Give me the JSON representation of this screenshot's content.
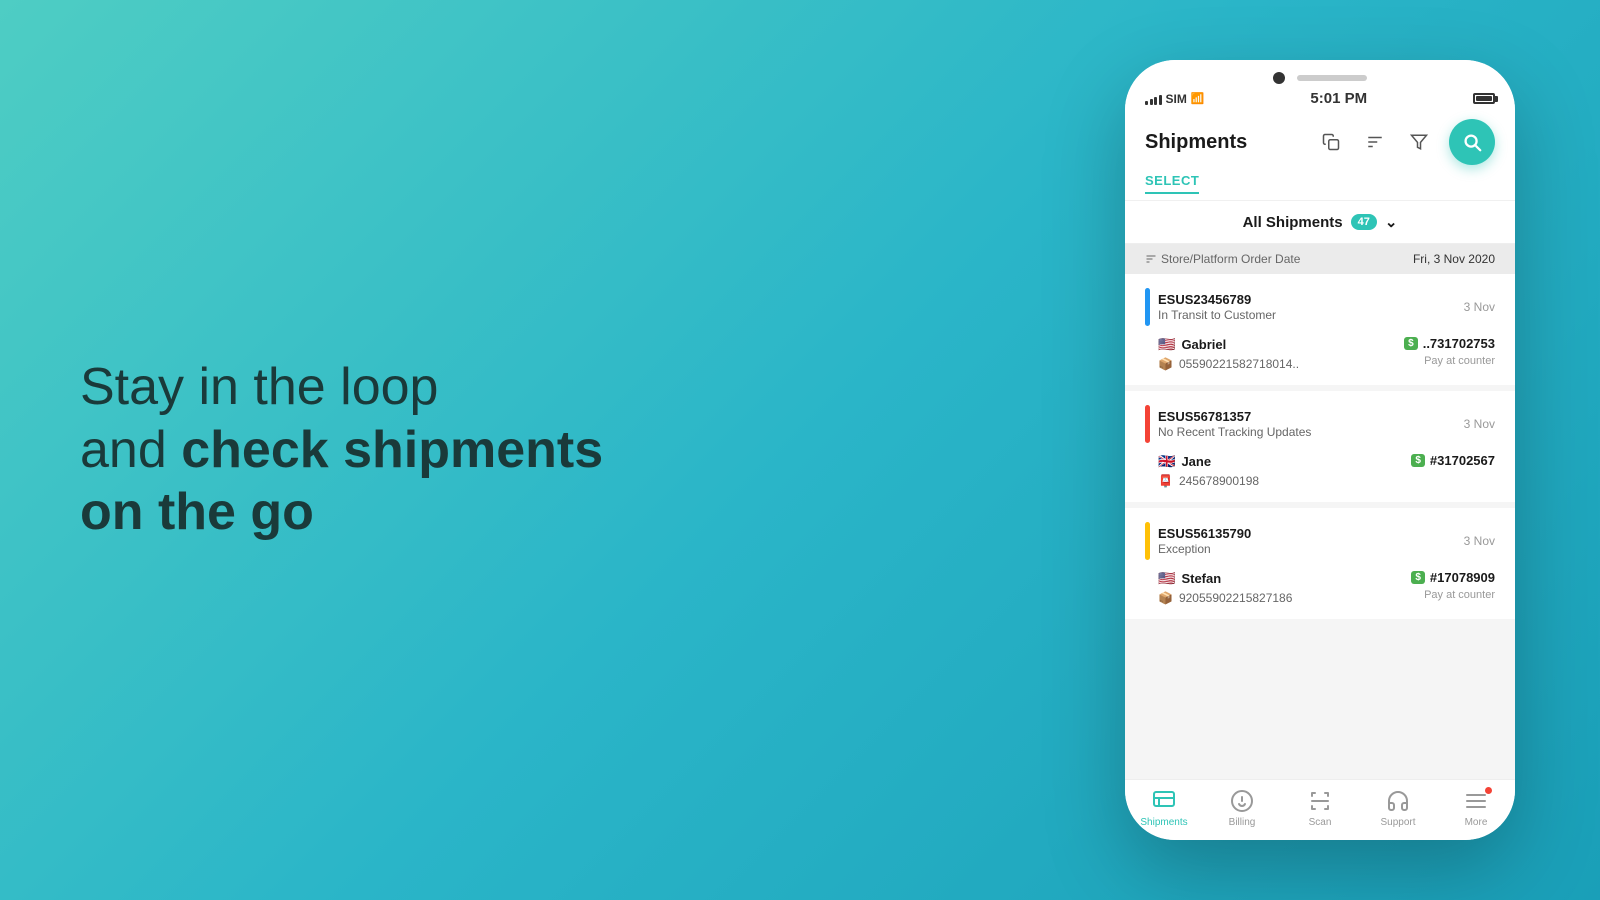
{
  "background": {
    "gradient_start": "#4ecdc4",
    "gradient_end": "#1a9fb8"
  },
  "tagline": {
    "line1": "Stay in the loop",
    "line2_prefix": "and ",
    "line2_bold": "check shipments",
    "line3": "on the go"
  },
  "phone": {
    "status_bar": {
      "carrier": "SIM",
      "time": "5:01 PM",
      "battery": "full"
    },
    "header": {
      "title": "Shipments",
      "select_label": "SELECT"
    },
    "filter": {
      "label": "All Shipments",
      "count": "47"
    },
    "date_header": {
      "sort_label": "Store/Platform Order Date",
      "date": "Fri, 3 Nov 2020"
    },
    "shipments": [
      {
        "id": "ESUS23456789",
        "status": "In Transit to Customer",
        "status_color": "blue",
        "date": "3 Nov",
        "customer_name": "Gabriel",
        "customer_flag": "🇺🇸",
        "tracking_carrier": "📦",
        "tracking_number": "05590221582718014..",
        "order_id": "..731702753",
        "payment": "Pay at counter"
      },
      {
        "id": "ESUS56781357",
        "status": "No Recent Tracking Updates",
        "status_color": "red",
        "date": "3 Nov",
        "customer_name": "Jane",
        "customer_flag": "🇬🇧",
        "tracking_carrier": "📮",
        "tracking_number": "245678900198",
        "order_id": "#31702567",
        "payment": ""
      },
      {
        "id": "ESUS56135790",
        "status": "Exception",
        "status_color": "yellow",
        "date": "3 Nov",
        "customer_name": "Stefan",
        "customer_flag": "🇺🇸",
        "tracking_carrier": "📦",
        "tracking_number": "92055902215827186",
        "order_id": "#17078909",
        "payment": "Pay at counter"
      }
    ],
    "bottom_nav": [
      {
        "id": "shipments",
        "label": "Shipments",
        "active": true,
        "has_dot": false
      },
      {
        "id": "billing",
        "label": "Billing",
        "active": false,
        "has_dot": false
      },
      {
        "id": "scan",
        "label": "Scan",
        "active": false,
        "has_dot": false
      },
      {
        "id": "support",
        "label": "Support",
        "active": false,
        "has_dot": false
      },
      {
        "id": "more",
        "label": "More",
        "active": false,
        "has_dot": true
      }
    ]
  }
}
